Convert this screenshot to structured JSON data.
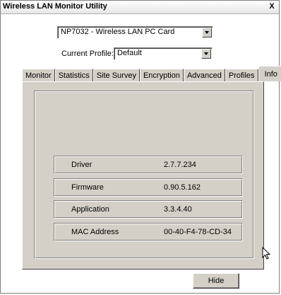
{
  "window": {
    "title": "Wireless LAN Monitor Utility",
    "close_label": "X"
  },
  "adapter": {
    "selected": "NP7032 - Wireless LAN PC Card"
  },
  "profile": {
    "label": "Current Profile:",
    "selected": "Default"
  },
  "tabs": [
    {
      "label": "Monitor"
    },
    {
      "label": "Statistics"
    },
    {
      "label": "Site Survey"
    },
    {
      "label": "Encryption"
    },
    {
      "label": "Advanced"
    },
    {
      "label": "Profiles"
    },
    {
      "label": "Info",
      "active": true
    }
  ],
  "info": {
    "rows": [
      {
        "label": "Driver",
        "value": "2.7.7.234"
      },
      {
        "label": "Firmware",
        "value": "0.90.5.162"
      },
      {
        "label": "Application",
        "value": "3.3.4.40"
      },
      {
        "label": "MAC Address",
        "value": "00-40-F4-78-CD-34"
      }
    ]
  },
  "buttons": {
    "hide_label": "Hide"
  }
}
